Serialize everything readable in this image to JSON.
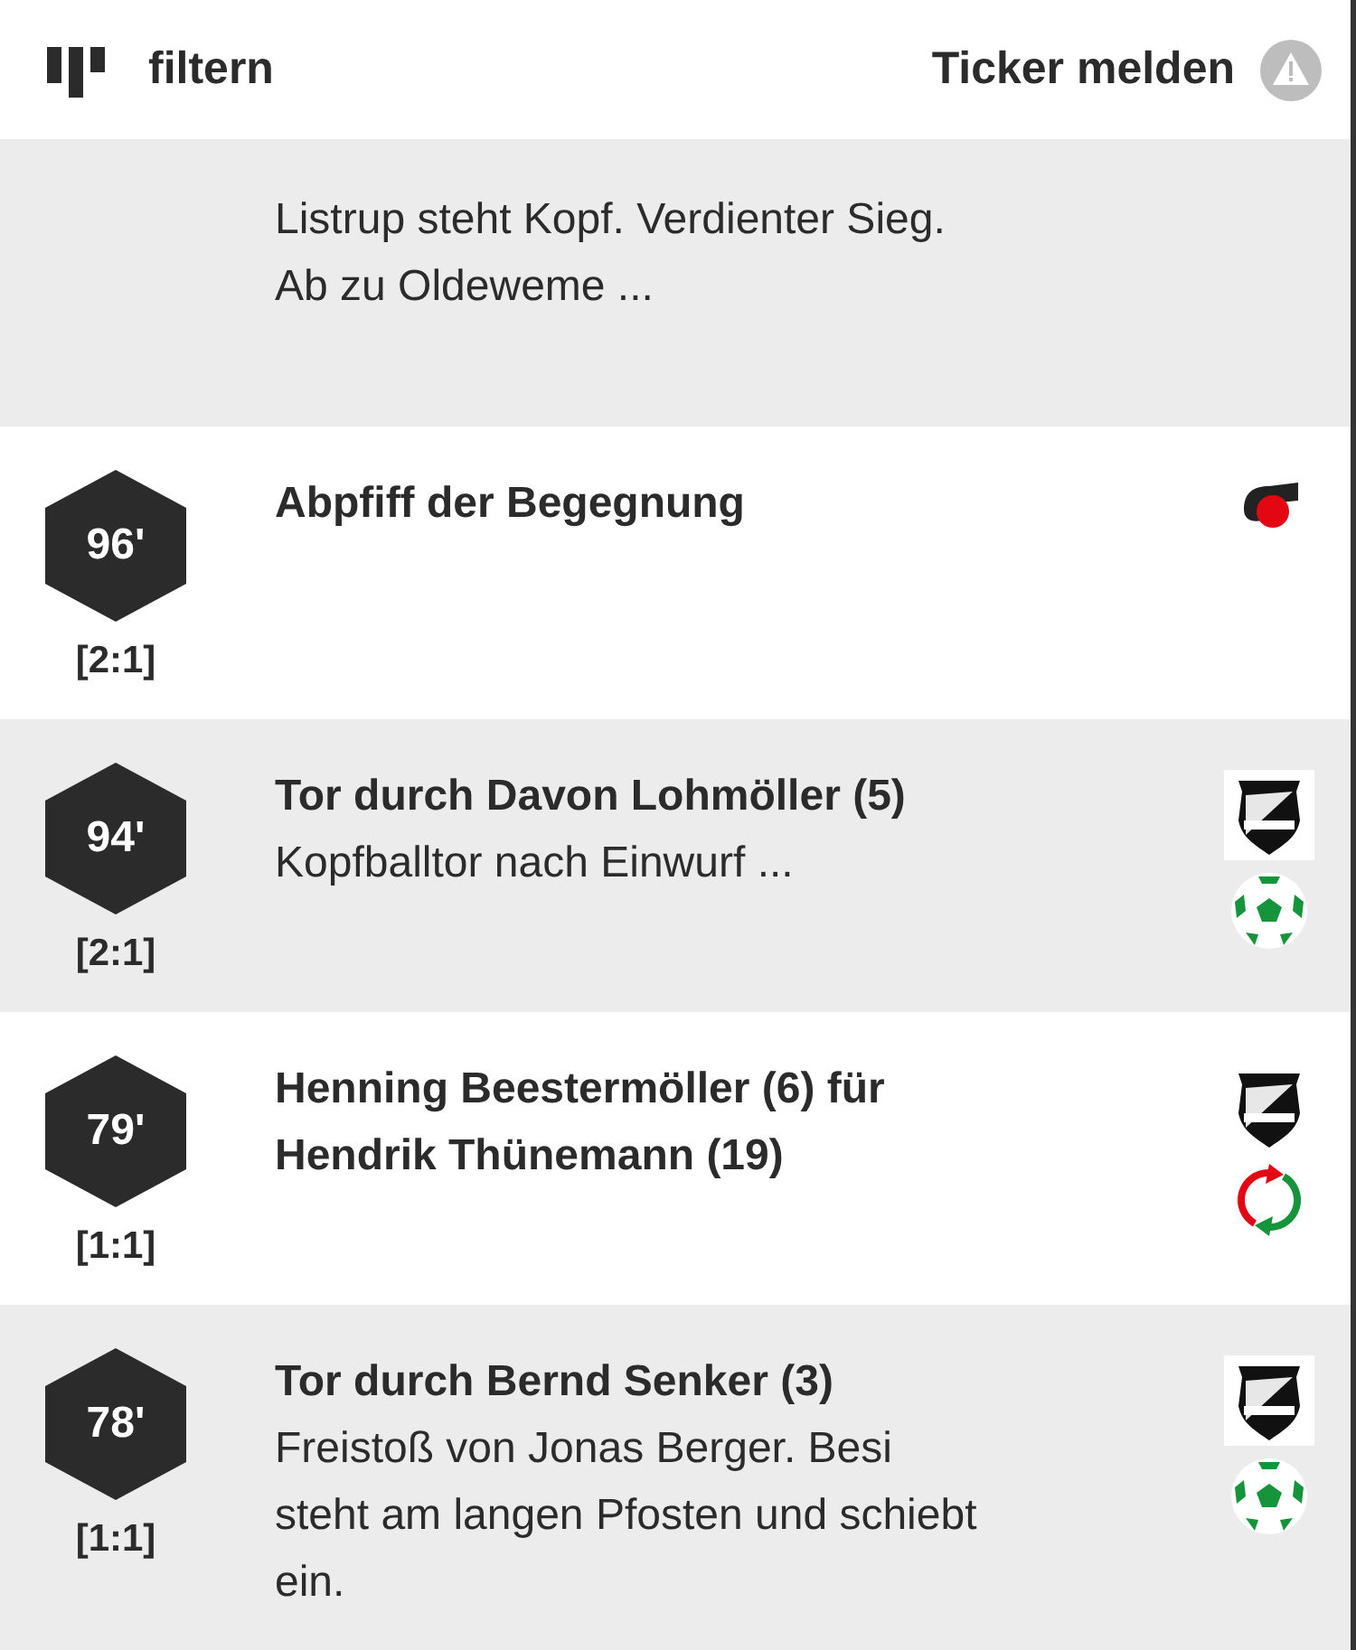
{
  "header": {
    "filter_label": "filtern",
    "report_label": "Ticker melden"
  },
  "intro": {
    "text": "Listrup steht Kopf. Verdienter Sieg.\nAb zu Oldeweme ..."
  },
  "events": [
    {
      "minute": "96'",
      "score": "[2:1]",
      "title": "Abpfiff der Begegnung",
      "icons": [
        {
          "kind": "whistle"
        }
      ]
    },
    {
      "minute": "94'",
      "score": "[2:1]",
      "title": "Tor durch Davon Lohmöller (5)",
      "text": "Kopfballtor nach Einwurf ...",
      "icons": [
        {
          "kind": "crest"
        },
        {
          "kind": "goal"
        }
      ]
    },
    {
      "minute": "79'",
      "score": "[1:1]",
      "title": "Henning Beestermöller (6) für Hendrik Thünemann (19)",
      "icons": [
        {
          "kind": "crest"
        },
        {
          "kind": "substitution"
        }
      ]
    },
    {
      "minute": "78'",
      "score": "[1:1]",
      "title": "Tor durch Bernd Senker (3)",
      "text": "Freistoß von Jonas Berger. Besi steht am langen Pfosten und schiebt ein.",
      "icons": [
        {
          "kind": "crest"
        },
        {
          "kind": "goal"
        }
      ]
    }
  ]
}
